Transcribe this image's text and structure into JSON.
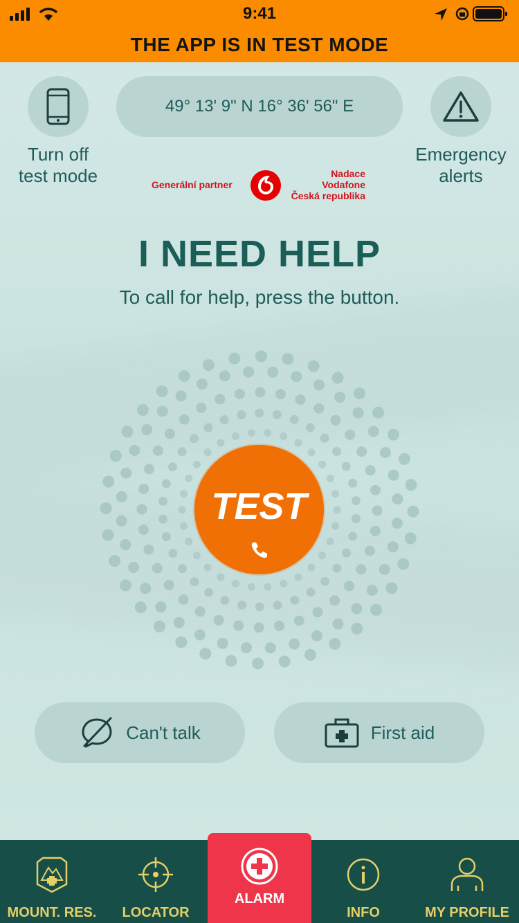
{
  "status_bar": {
    "time": "9:41"
  },
  "banner": "THE APP IS IN TEST MODE",
  "top": {
    "left_label": "Turn off\ntest mode",
    "coordinates": "49° 13' 9\" N 16° 36' 56\" E",
    "right_label": "Emergency\nalerts"
  },
  "partner": {
    "left": "Generální partner",
    "right_lines": [
      "Nadace",
      "Vodafone",
      "Česká republika"
    ]
  },
  "main": {
    "headline": "I NEED HELP",
    "subline": "To call for help, press the button.",
    "button_label": "TEST"
  },
  "actions": {
    "cant_talk": "Can't talk",
    "first_aid": "First aid"
  },
  "tabs": [
    {
      "label": "MOUNT. RES.",
      "icon": "mountain-rescue-icon"
    },
    {
      "label": "LOCATOR",
      "icon": "crosshair-icon"
    },
    {
      "label": "ALARM",
      "icon": "plus-circle-icon",
      "active": true
    },
    {
      "label": "INFO",
      "icon": "info-icon"
    },
    {
      "label": "MY PROFILE",
      "icon": "profile-icon"
    }
  ],
  "colors": {
    "banner": "#fb8c00",
    "test_button": "#f07006",
    "primary_text": "#1b5e58",
    "tabbar": "#174e48",
    "tab_text": "#e4cf68",
    "alarm_tab": "#ef3549",
    "vodafone_red": "#d0141c"
  }
}
